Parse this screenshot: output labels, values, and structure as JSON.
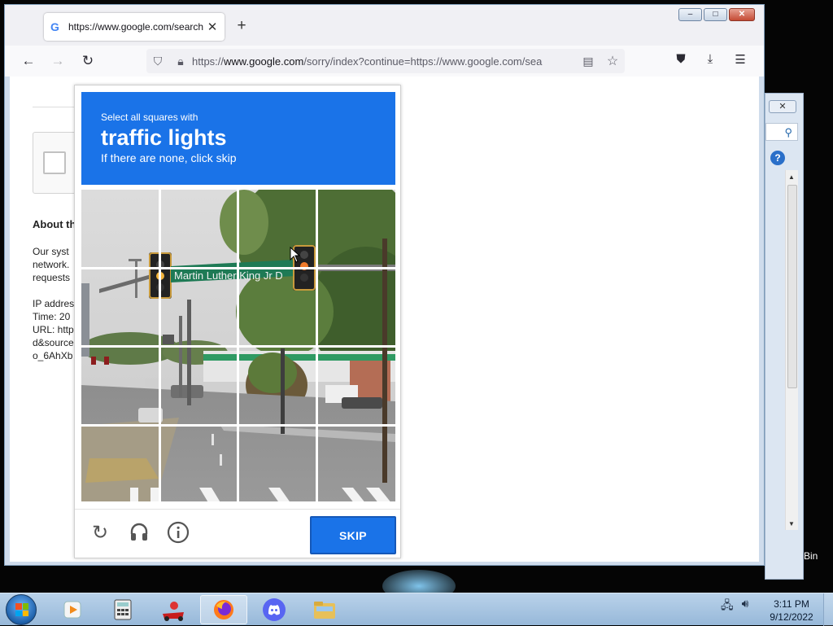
{
  "browser": {
    "tab_title": "https://www.google.com/search",
    "tab_close": "✕",
    "new_tab": "+",
    "url_prefix": "https://",
    "url_host": "www.google.com",
    "url_path": "/sorry/index?continue=https://www.google.com/sea",
    "window_buttons": {
      "minimize": "–",
      "maximize": "□",
      "close": "✕"
    }
  },
  "page": {
    "about_heading": "About th",
    "text_lines": [
      "Our syst",
      "network.",
      "requests"
    ],
    "info_lines": [
      "IP addres",
      "Time: 20",
      "URL: http",
      "d&source",
      "o_6AhXb"
    ]
  },
  "captcha": {
    "instruction_small": "Select all squares with",
    "target": "traffic lights",
    "instruction_sub": "If there are none, click skip",
    "street_sign": "Martin Luther King Jr D",
    "skip_label": "SKIP",
    "grid_size": 4
  },
  "background_window": {
    "close": "✕"
  },
  "desktop": {
    "recycle_label": "Bin"
  },
  "taskbar": {
    "time": "3:11 PM",
    "date": "9/12/2022"
  },
  "colors": {
    "captcha_blue": "#1a73e8",
    "taskbar": "#a8c5e2",
    "close_red": "#c44a34"
  }
}
